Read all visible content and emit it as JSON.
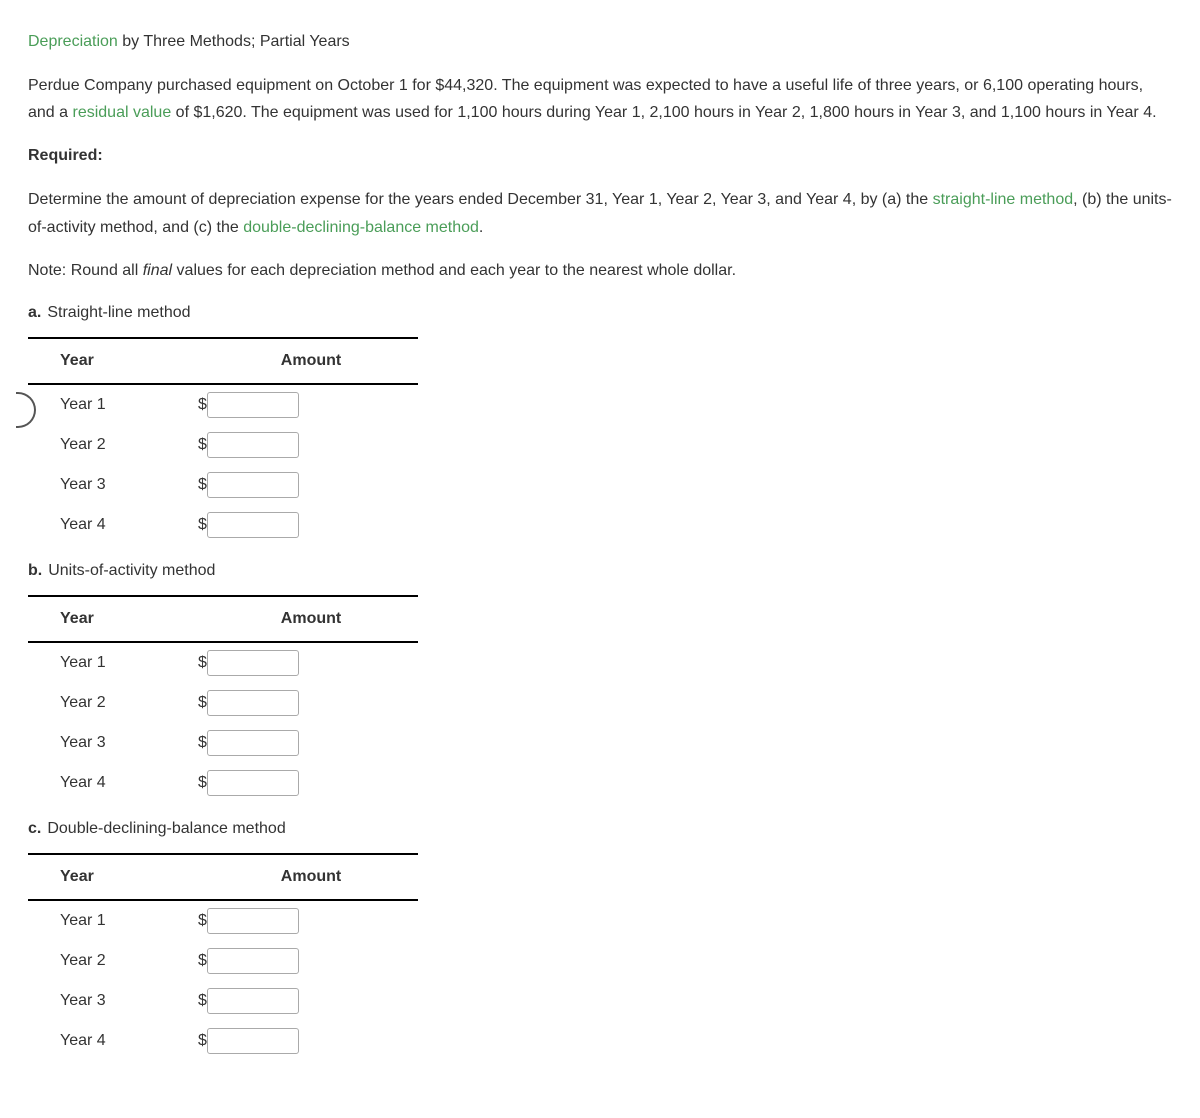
{
  "title": {
    "link": "Depreciation",
    "rest": " by Three Methods; Partial Years"
  },
  "intro": {
    "t1": "Perdue Company purchased equipment on October 1 for $44,320. The equipment was expected to have a useful life of three years, or 6,100 operating hours, and a ",
    "link1": "residual value",
    "t2": " of $1,620. The equipment was used for 1,100 hours during Year 1, 2,100 hours in Year 2, 1,800 hours in Year 3, and 1,100 hours in Year 4."
  },
  "required_label": "Required:",
  "instruction": {
    "t1": "Determine the amount of depreciation expense for the years ended December 31, Year 1, Year 2, Year 3, and Year 4, by (a) the ",
    "link1": "straight-line method",
    "t2": ", (b) the units-of-activity method, and (c) the ",
    "link2": "double-declining-balance method",
    "t3": "."
  },
  "note": {
    "t1": "Note: Round all ",
    "ital": "final",
    "t2": " values for each depreciation method and each year to the nearest whole dollar."
  },
  "headers": {
    "year": "Year",
    "amount": "Amount"
  },
  "currency": "$",
  "sections": {
    "a": {
      "letter": "a.",
      "label": "Straight-line method",
      "rows": [
        "Year 1",
        "Year 2",
        "Year 3",
        "Year 4"
      ],
      "values": [
        "",
        "",
        "",
        ""
      ]
    },
    "b": {
      "letter": "b.",
      "label": "Units-of-activity method",
      "rows": [
        "Year 1",
        "Year 2",
        "Year 3",
        "Year 4"
      ],
      "values": [
        "",
        "",
        "",
        ""
      ]
    },
    "c": {
      "letter": "c.",
      "label": "Double-declining-balance method",
      "rows": [
        "Year 1",
        "Year 2",
        "Year 3",
        "Year 4"
      ],
      "values": [
        "",
        "",
        "",
        ""
      ]
    }
  }
}
